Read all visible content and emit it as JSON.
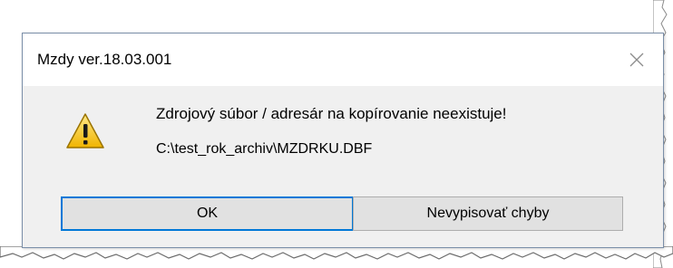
{
  "dialog": {
    "title": "Mzdy ver.18.03.001",
    "close_icon": "close-icon",
    "icon": "warning-icon",
    "message": "Zdrojový súbor / adresár na kopírovanie neexistuje!",
    "path": "C:\\test_rok_archiv\\MZDRKU.DBF",
    "buttons": {
      "ok_label": "OK",
      "suppress_label": "Nevypisovať chyby"
    }
  },
  "colors": {
    "title_background": "#ffffff",
    "body_background": "#f0f0f0",
    "default_button_border": "#0078d7",
    "button_background": "#e1e1e1",
    "warning_yellow": "#f5c400"
  }
}
